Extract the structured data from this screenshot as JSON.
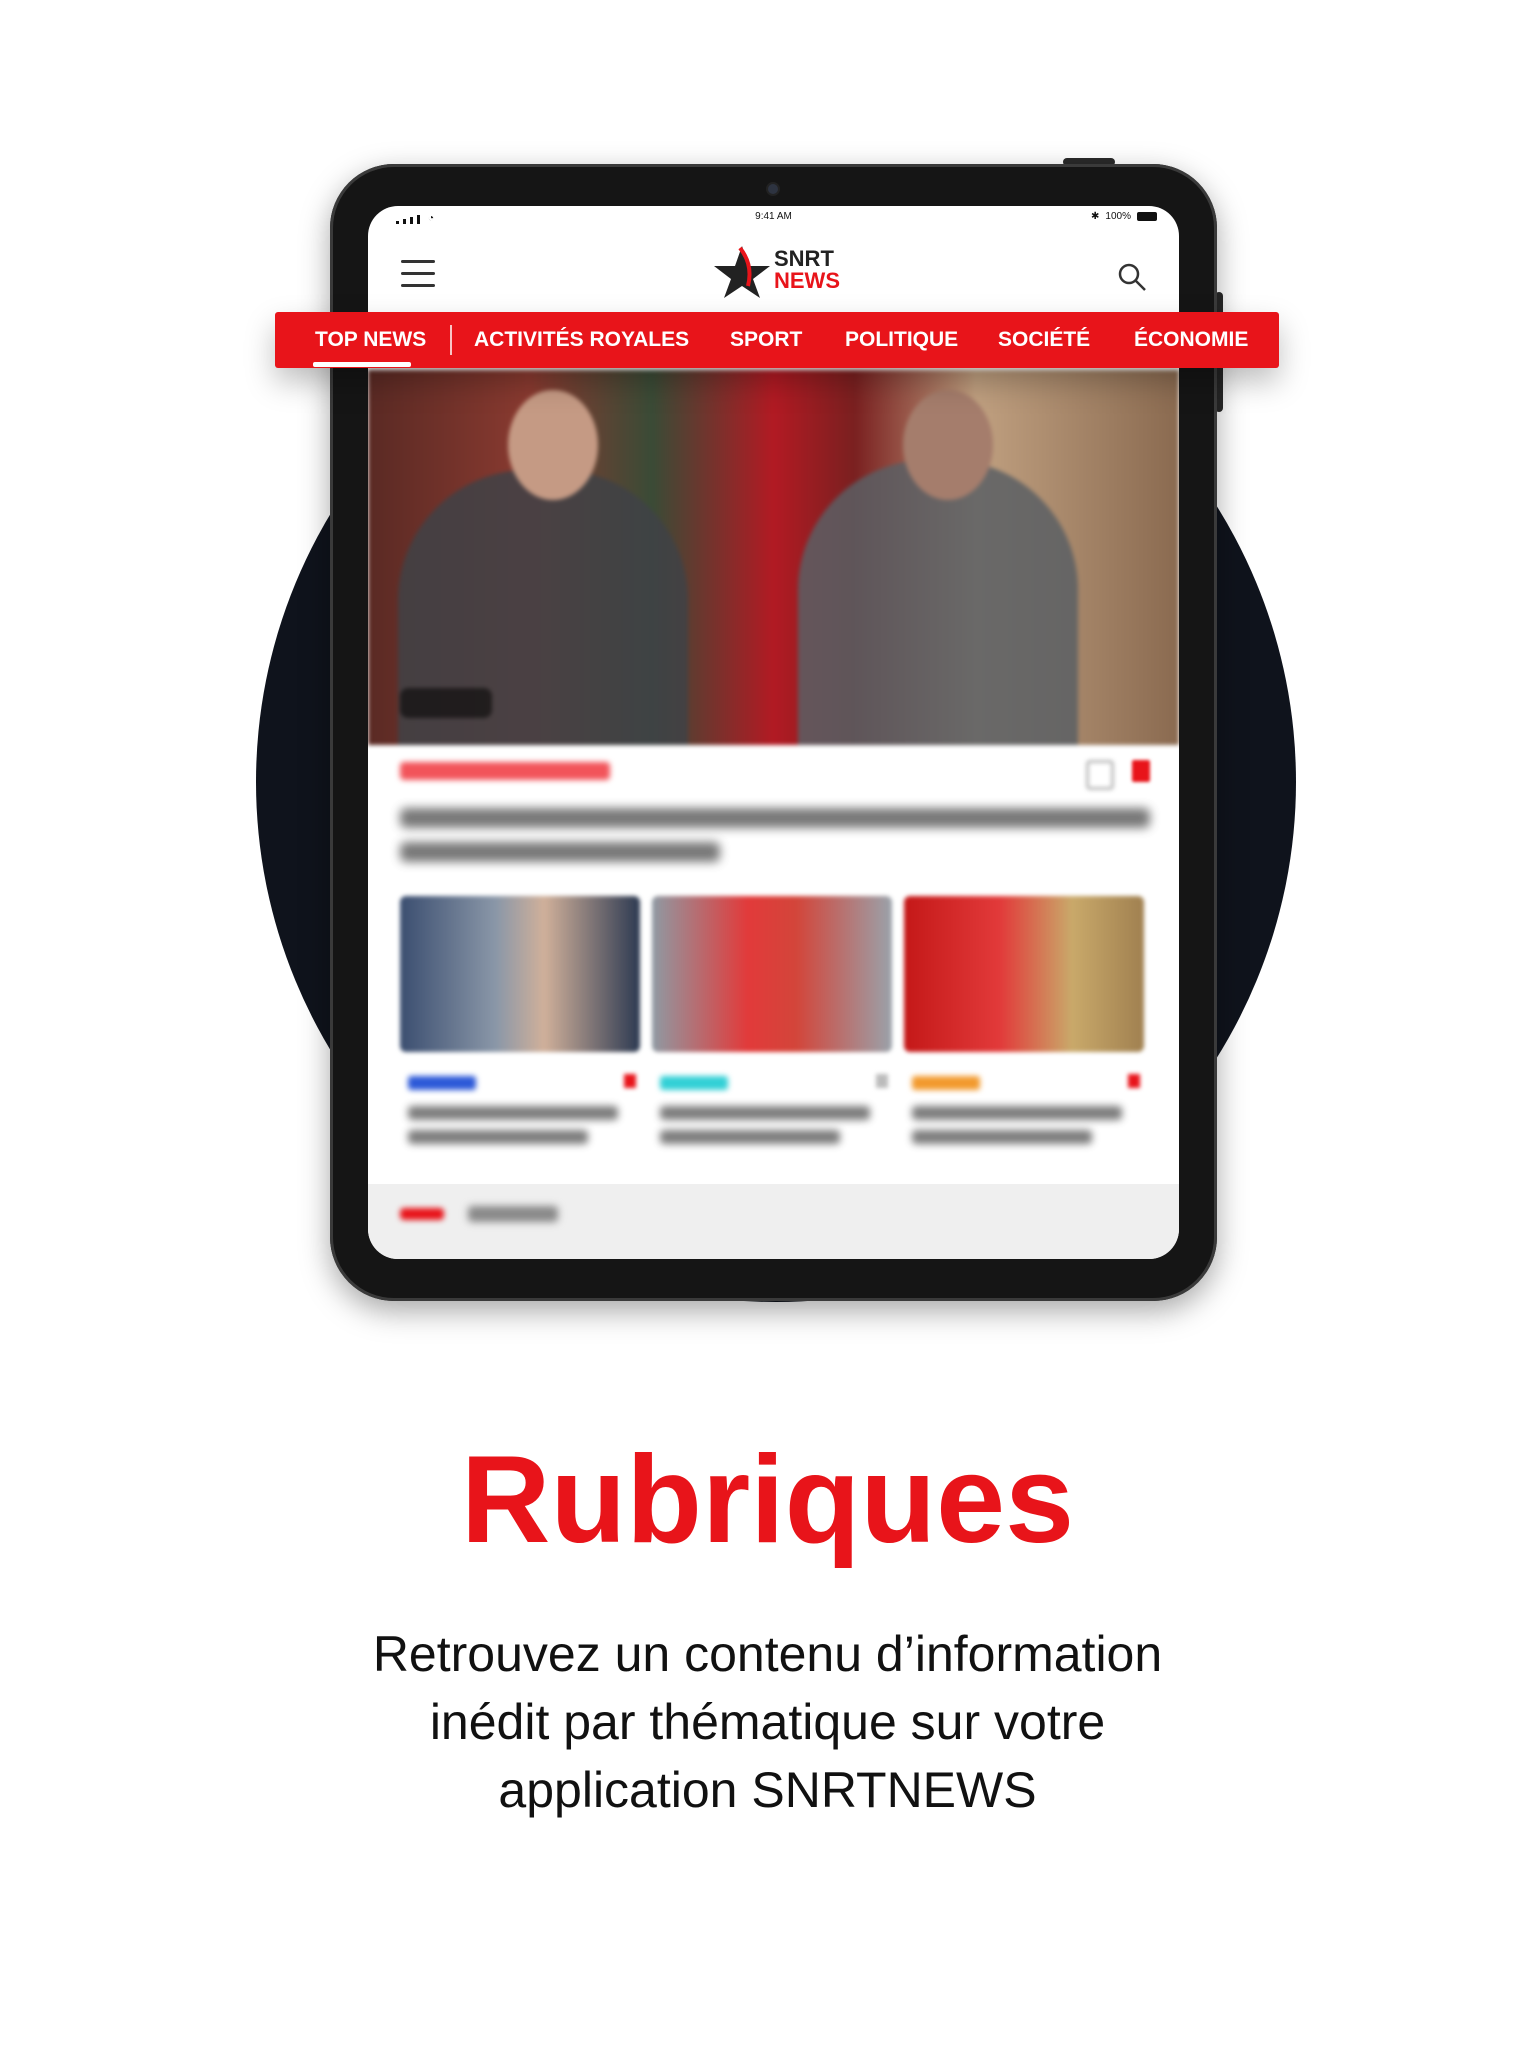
{
  "status_bar": {
    "time": "9:41 AM",
    "battery": "100%"
  },
  "app": {
    "logo_line1": "SNRT",
    "logo_line2": "NEWS"
  },
  "categories": [
    {
      "label": "TOP NEWS",
      "active": true
    },
    {
      "label": "ACTIVITÉS ROYALES"
    },
    {
      "label": "SPORT"
    },
    {
      "label": "POLITIQUE"
    },
    {
      "label": "SOCIÉTÉ"
    },
    {
      "label": "ÉCONOMIE"
    }
  ],
  "promo": {
    "title": "Rubriques",
    "description_lines": [
      "Retrouvez un contenu d’information",
      "inédit par thématique sur votre",
      "application SNRTNEWS"
    ]
  },
  "colors": {
    "brand_red": "#e8141a",
    "circle_bg": "#0f131c"
  },
  "icons": [
    "menu-icon",
    "search-icon",
    "star-logo-icon",
    "share-icon",
    "bookmark-icon",
    "wifi-icon",
    "bluetooth-icon",
    "battery-icon"
  ]
}
